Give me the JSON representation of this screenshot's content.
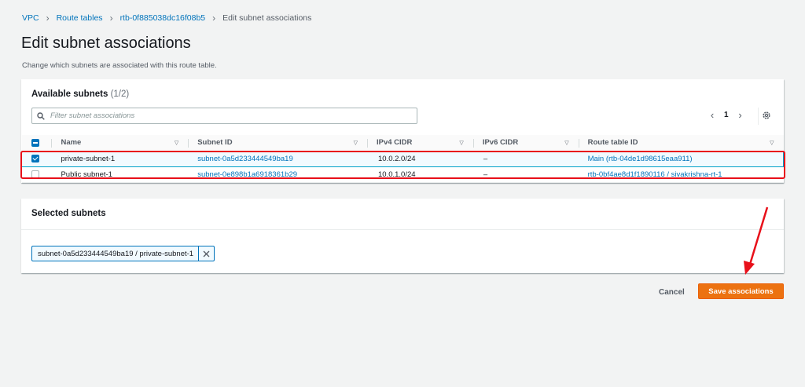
{
  "breadcrumb": [
    "VPC",
    "Route tables",
    "rtb-0f885038dc16f08b5",
    "Edit subnet associations"
  ],
  "page": {
    "title": "Edit subnet associations",
    "description": "Change which subnets are associated with this route table."
  },
  "available": {
    "title": "Available subnets",
    "count": "(1/2)",
    "search_placeholder": "Filter subnet associations",
    "page_number": "1",
    "columns": [
      "Name",
      "Subnet ID",
      "IPv4 CIDR",
      "IPv6 CIDR",
      "Route table ID"
    ],
    "rows": [
      {
        "checked": true,
        "name": "private-subnet-1",
        "subnet_id": "subnet-0a5d233444549ba19",
        "ipv4": "10.0.2.0/24",
        "ipv6": "–",
        "route_table": "Main (rtb-04de1d98615eaa911)"
      },
      {
        "checked": false,
        "name": "Public subnet-1",
        "subnet_id": "subnet-0e898b1a6918361b29",
        "ipv4": "10.0.1.0/24",
        "ipv6": "–",
        "route_table": "rtb-0bf4ae8d1f1890116 / sivakrishna-rt-1"
      }
    ]
  },
  "selected": {
    "title": "Selected subnets",
    "token": "subnet-0a5d233444549ba19 / private-subnet-1"
  },
  "actions": {
    "cancel": "Cancel",
    "save": "Save associations"
  },
  "colors": {
    "accent": "#0073bb",
    "primary_button": "#ec7211",
    "highlight_box": "#e8101a"
  }
}
